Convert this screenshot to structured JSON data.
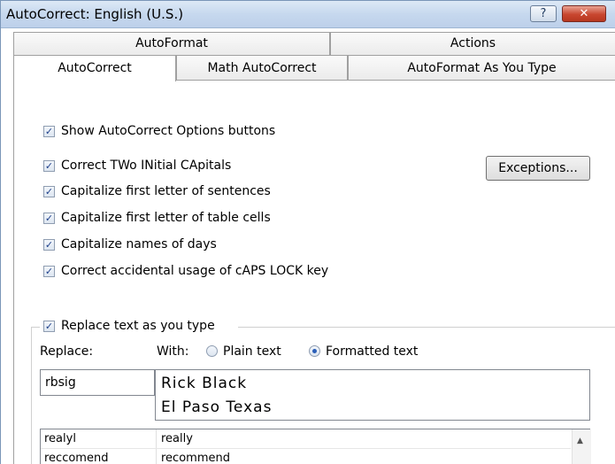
{
  "window": {
    "title": "AutoCorrect: English (U.S.)",
    "help_label": "?",
    "close_label": "✕"
  },
  "tabs": {
    "row1": [
      "AutoFormat",
      "Actions"
    ],
    "row2": [
      "AutoCorrect",
      "Math AutoCorrect",
      "AutoFormat As You Type"
    ],
    "active": "AutoCorrect"
  },
  "options": {
    "show_buttons": {
      "label": "Show AutoCorrect Options buttons",
      "checked": true
    },
    "two_initials": {
      "label": "Correct TWo INitial CApitals",
      "checked": true
    },
    "first_letter_sentences": {
      "label": "Capitalize first letter of sentences",
      "checked": true
    },
    "first_letter_cells": {
      "label": "Capitalize first letter of table cells",
      "checked": true
    },
    "names_of_days": {
      "label": "Capitalize names of days",
      "checked": true
    },
    "caps_lock": {
      "label": "Correct accidental usage of cAPS LOCK key",
      "checked": true
    },
    "exceptions_button": "Exceptions..."
  },
  "replace_section": {
    "replace_as_you_type": {
      "label": "Replace text as you type",
      "checked": true
    },
    "replace_label": "Replace:",
    "with_label": "With:",
    "plain_text_label": "Plain text",
    "formatted_text_label": "Formatted text",
    "selected_format": "Formatted text",
    "replace_value": "rbsig",
    "with_value_line1": "Rick Black",
    "with_value_line2": "El Paso Texas"
  },
  "entries": [
    {
      "replace": "realyl",
      "with": "really"
    },
    {
      "replace": "reccomend",
      "with": "recommend"
    }
  ],
  "icons": {
    "check": "✓",
    "scroll_up": "▲"
  }
}
